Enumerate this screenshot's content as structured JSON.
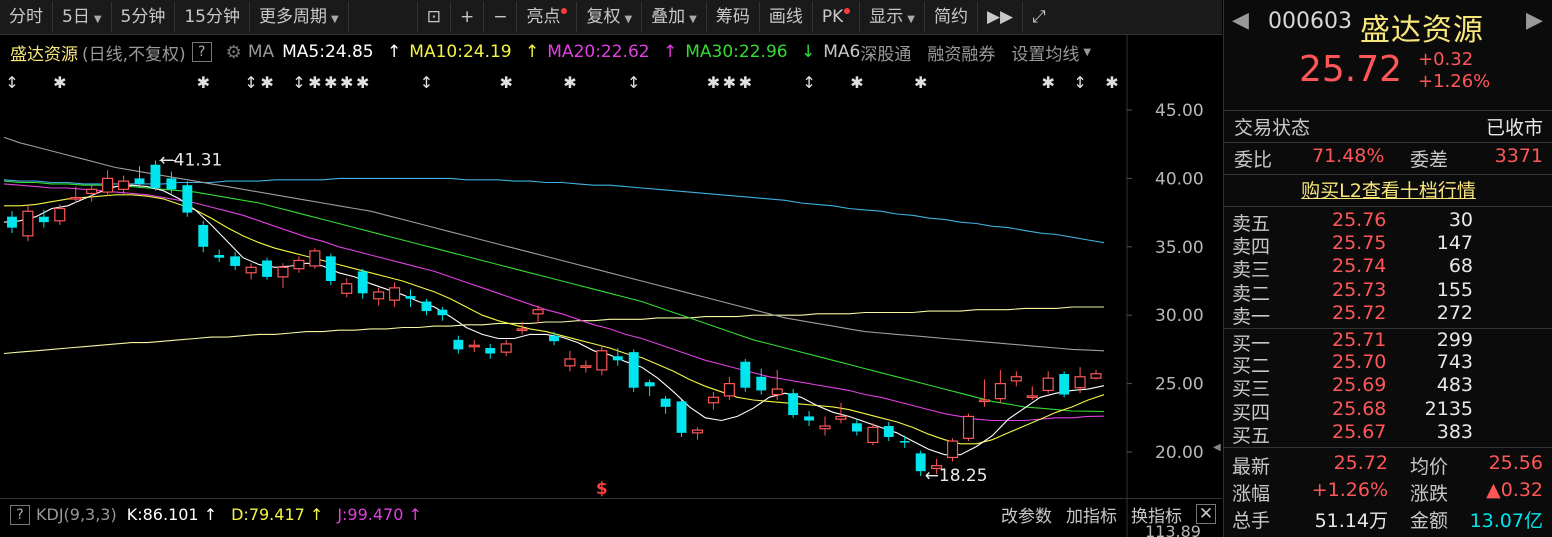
{
  "toolbar": {
    "left": [
      "分时",
      "5日",
      "5分钟",
      "15分钟",
      "更多周期"
    ],
    "tools": [
      "亮点",
      "复权",
      "叠加",
      "筹码",
      "画线",
      "PK",
      "显示",
      "简约"
    ]
  },
  "legend": {
    "name": "盛达资源",
    "mode": "(日线,不复权)",
    "qmark": "?",
    "ma_label": "MA",
    "ma5": "MA5:24.85",
    "ma10": "MA10:24.19",
    "ma20": "MA20:22.62",
    "ma30": "MA30:22.96",
    "ma60": "MA6",
    "links": [
      "深股通",
      "融资融券",
      "设置均线"
    ],
    "colors": {
      "ma5": "#ffffff",
      "ma10": "#f5f542",
      "ma20": "#e040e0",
      "ma30": "#33dd33",
      "ma60": "#9e9e9e",
      "ma120": "#3fb0e0",
      "ma250": "#f5f5a0"
    }
  },
  "kdj": {
    "name": "KDJ(9,3,3)",
    "k": "K:86.101",
    "d": "D:79.417",
    "j": "J:99.470",
    "tools": [
      "改参数",
      "加指标",
      "换指标"
    ],
    "axis_label": "113.89"
  },
  "chart_data": {
    "type": "candlestick",
    "y_ticks": [
      "45.00",
      "40.00",
      "35.00",
      "30.00",
      "25.00",
      "20.00"
    ],
    "ylim": [
      18.25,
      45.0
    ],
    "annotations": {
      "high": "41.31",
      "low": "18.25"
    },
    "marker_symbol": "$",
    "up_color": "#ff5757",
    "down_color": "#00e5ee",
    "candles": [
      {
        "o": 37.2,
        "c": 36.4,
        "h": 37.6,
        "l": 36.0
      },
      {
        "o": 35.8,
        "c": 37.6,
        "h": 38.0,
        "l": 35.4
      },
      {
        "o": 37.2,
        "c": 36.8,
        "h": 37.7,
        "l": 36.4
      },
      {
        "o": 36.9,
        "c": 37.8,
        "h": 38.1,
        "l": 36.6
      },
      {
        "o": 38.6,
        "c": 38.6,
        "h": 39.4,
        "l": 38.2
      },
      {
        "o": 38.9,
        "c": 39.2,
        "h": 39.6,
        "l": 38.3
      },
      {
        "o": 39.0,
        "c": 40.0,
        "h": 40.6,
        "l": 38.7
      },
      {
        "o": 39.2,
        "c": 39.8,
        "h": 40.2,
        "l": 38.8
      },
      {
        "o": 40.0,
        "c": 39.6,
        "h": 40.9,
        "l": 39.3
      },
      {
        "o": 41.0,
        "c": 39.3,
        "h": 41.31,
        "l": 39.1
      },
      {
        "o": 40.0,
        "c": 39.2,
        "h": 40.5,
        "l": 38.9
      },
      {
        "o": 39.5,
        "c": 37.5,
        "h": 39.8,
        "l": 37.2
      },
      {
        "o": 36.6,
        "c": 35.0,
        "h": 36.9,
        "l": 34.6
      },
      {
        "o": 34.4,
        "c": 34.2,
        "h": 34.8,
        "l": 33.9
      },
      {
        "o": 34.3,
        "c": 33.6,
        "h": 34.6,
        "l": 33.3
      },
      {
        "o": 33.1,
        "c": 33.5,
        "h": 33.8,
        "l": 32.6
      },
      {
        "o": 34.0,
        "c": 32.8,
        "h": 34.2,
        "l": 32.6
      },
      {
        "o": 32.8,
        "c": 33.5,
        "h": 33.8,
        "l": 32.0
      },
      {
        "o": 33.4,
        "c": 34.0,
        "h": 34.3,
        "l": 33.1
      },
      {
        "o": 33.6,
        "c": 34.7,
        "h": 34.9,
        "l": 33.4
      },
      {
        "o": 34.3,
        "c": 32.5,
        "h": 34.5,
        "l": 32.2
      },
      {
        "o": 31.6,
        "c": 32.3,
        "h": 32.7,
        "l": 31.3
      },
      {
        "o": 33.2,
        "c": 31.6,
        "h": 33.4,
        "l": 31.2
      },
      {
        "o": 31.2,
        "c": 31.7,
        "h": 32.0,
        "l": 30.7
      },
      {
        "o": 31.1,
        "c": 32.0,
        "h": 32.4,
        "l": 30.6
      },
      {
        "o": 31.4,
        "c": 31.2,
        "h": 31.9,
        "l": 30.6
      },
      {
        "o": 31.0,
        "c": 30.3,
        "h": 31.2,
        "l": 30.0
      },
      {
        "o": 30.4,
        "c": 30.0,
        "h": 30.6,
        "l": 29.6
      },
      {
        "o": 28.2,
        "c": 27.5,
        "h": 28.5,
        "l": 27.2
      },
      {
        "o": 27.8,
        "c": 27.8,
        "h": 28.2,
        "l": 27.3
      },
      {
        "o": 27.6,
        "c": 27.2,
        "h": 27.9,
        "l": 26.8
      },
      {
        "o": 27.3,
        "c": 27.9,
        "h": 28.2,
        "l": 27.0
      },
      {
        "o": 29.0,
        "c": 29.0,
        "h": 29.5,
        "l": 28.6
      },
      {
        "o": 30.1,
        "c": 30.4,
        "h": 30.7,
        "l": 29.4
      },
      {
        "o": 28.5,
        "c": 28.1,
        "h": 28.8,
        "l": 27.8
      },
      {
        "o": 26.3,
        "c": 26.8,
        "h": 27.4,
        "l": 25.9
      },
      {
        "o": 26.3,
        "c": 26.3,
        "h": 26.7,
        "l": 25.8
      },
      {
        "o": 26.0,
        "c": 27.4,
        "h": 27.8,
        "l": 25.6
      },
      {
        "o": 27.0,
        "c": 26.7,
        "h": 27.6,
        "l": 26.3
      },
      {
        "o": 27.3,
        "c": 24.7,
        "h": 27.5,
        "l": 24.4
      },
      {
        "o": 25.1,
        "c": 24.8,
        "h": 25.3,
        "l": 24.1
      },
      {
        "o": 23.9,
        "c": 23.3,
        "h": 24.1,
        "l": 22.8
      },
      {
        "o": 23.7,
        "c": 21.4,
        "h": 23.8,
        "l": 21.1
      },
      {
        "o": 21.4,
        "c": 21.6,
        "h": 21.8,
        "l": 20.9
      },
      {
        "o": 23.6,
        "c": 24.0,
        "h": 24.4,
        "l": 23.1
      },
      {
        "o": 24.1,
        "c": 25.0,
        "h": 25.5,
        "l": 23.8
      },
      {
        "o": 26.6,
        "c": 24.7,
        "h": 26.8,
        "l": 24.4
      },
      {
        "o": 25.5,
        "c": 24.5,
        "h": 26.1,
        "l": 24.2
      },
      {
        "o": 24.2,
        "c": 24.6,
        "h": 26.0,
        "l": 23.8
      },
      {
        "o": 24.3,
        "c": 22.7,
        "h": 24.6,
        "l": 22.5
      },
      {
        "o": 22.6,
        "c": 22.3,
        "h": 23.0,
        "l": 21.9
      },
      {
        "o": 21.7,
        "c": 21.9,
        "h": 22.6,
        "l": 21.2
      },
      {
        "o": 22.4,
        "c": 22.6,
        "h": 23.6,
        "l": 22.1
      },
      {
        "o": 22.1,
        "c": 21.5,
        "h": 22.4,
        "l": 21.2
      },
      {
        "o": 20.7,
        "c": 21.8,
        "h": 22.1,
        "l": 20.5
      },
      {
        "o": 21.9,
        "c": 21.1,
        "h": 22.2,
        "l": 20.8
      },
      {
        "o": 20.8,
        "c": 20.7,
        "h": 21.2,
        "l": 20.3
      },
      {
        "o": 19.9,
        "c": 18.6,
        "h": 20.1,
        "l": 18.25
      },
      {
        "o": 18.8,
        "c": 19.0,
        "h": 19.5,
        "l": 18.4
      },
      {
        "o": 19.6,
        "c": 20.8,
        "h": 21.0,
        "l": 19.3
      },
      {
        "o": 21.0,
        "c": 22.6,
        "h": 22.8,
        "l": 20.8
      },
      {
        "o": 23.8,
        "c": 23.8,
        "h": 25.3,
        "l": 23.3
      },
      {
        "o": 23.9,
        "c": 25.0,
        "h": 26.0,
        "l": 23.6
      },
      {
        "o": 25.2,
        "c": 25.5,
        "h": 25.9,
        "l": 24.8
      },
      {
        "o": 24.1,
        "c": 24.1,
        "h": 24.8,
        "l": 23.8
      },
      {
        "o": 24.5,
        "c": 25.4,
        "h": 25.9,
        "l": 24.3
      },
      {
        "o": 25.7,
        "c": 24.2,
        "h": 25.9,
        "l": 24.0
      },
      {
        "o": 24.7,
        "c": 25.5,
        "h": 26.2,
        "l": 24.3
      },
      {
        "o": 25.4,
        "c": 25.72,
        "h": 26.0,
        "l": 25.3
      }
    ],
    "ma_lines": {
      "ma5": [
        36.8,
        36.9,
        37.2,
        37.8,
        38.0,
        38.5,
        39.0,
        39.4,
        39.5,
        39.4,
        39.1,
        38.5,
        37.7,
        36.6,
        35.4,
        34.2,
        33.7,
        33.5,
        33.6,
        33.8,
        33.6,
        33.1,
        32.8,
        32.3,
        31.9,
        31.5,
        31.0,
        30.6,
        29.9,
        29.1,
        28.6,
        28.3,
        28.3,
        28.6,
        28.6,
        28.4,
        28.0,
        27.4,
        27.1,
        26.6,
        26.2,
        25.4,
        24.4,
        23.3,
        22.5,
        22.3,
        22.6,
        23.2,
        24.0,
        24.3,
        24.0,
        23.4,
        22.9,
        22.6,
        22.2,
        21.8,
        21.4,
        20.8,
        20.2,
        19.8,
        19.8,
        20.4,
        21.2,
        22.4,
        23.2,
        24.0,
        24.3,
        24.5,
        24.6,
        24.85
      ],
      "ma10": [
        38.0,
        38.0,
        38.1,
        38.3,
        38.5,
        38.6,
        38.7,
        38.8,
        38.8,
        38.7,
        38.5,
        38.1,
        37.7,
        37.1,
        36.4,
        35.8,
        35.3,
        34.9,
        34.6,
        34.3,
        34.0,
        33.7,
        33.4,
        33.1,
        32.8,
        32.5,
        32.1,
        31.7,
        31.2,
        30.6,
        30.0,
        29.6,
        29.3,
        29.0,
        28.8,
        28.5,
        28.2,
        27.9,
        27.6,
        27.2,
        26.9,
        26.4,
        25.9,
        25.3,
        24.8,
        24.4,
        24.0,
        23.8,
        23.7,
        23.6,
        23.5,
        23.4,
        23.3,
        23.1,
        22.8,
        22.5,
        22.2,
        21.8,
        21.3,
        20.9,
        20.6,
        20.6,
        20.9,
        21.4,
        21.9,
        22.4,
        22.9,
        23.3,
        23.8,
        24.19
      ],
      "ma20": [
        39.6,
        39.5,
        39.4,
        39.3,
        39.3,
        39.2,
        39.1,
        39.0,
        38.9,
        38.8,
        38.6,
        38.4,
        38.2,
        37.9,
        37.6,
        37.3,
        36.9,
        36.5,
        36.1,
        35.7,
        35.4,
        35.0,
        34.7,
        34.4,
        34.1,
        33.8,
        33.5,
        33.2,
        32.8,
        32.4,
        32.0,
        31.6,
        31.2,
        30.8,
        30.4,
        30.1,
        29.7,
        29.3,
        29.0,
        28.6,
        28.3,
        27.9,
        27.5,
        27.1,
        26.7,
        26.4,
        26.1,
        25.8,
        25.5,
        25.3,
        25.1,
        24.9,
        24.7,
        24.5,
        24.2,
        24.0,
        23.7,
        23.4,
        23.1,
        22.8,
        22.6,
        22.4,
        22.3,
        22.3,
        22.3,
        22.4,
        22.5,
        22.5,
        22.6,
        22.62
      ],
      "ma30": [
        39.8,
        39.7,
        39.7,
        39.6,
        39.6,
        39.5,
        39.5,
        39.4,
        39.4,
        39.3,
        39.2,
        39.1,
        39.0,
        38.8,
        38.6,
        38.4,
        38.2,
        37.9,
        37.6,
        37.3,
        37.0,
        36.7,
        36.4,
        36.1,
        35.8,
        35.5,
        35.2,
        34.9,
        34.6,
        34.3,
        34.0,
        33.7,
        33.4,
        33.1,
        32.8,
        32.5,
        32.2,
        31.9,
        31.6,
        31.3,
        31.0,
        30.6,
        30.2,
        29.8,
        29.4,
        29.0,
        28.6,
        28.2,
        27.9,
        27.6,
        27.3,
        27.0,
        26.7,
        26.4,
        26.1,
        25.8,
        25.5,
        25.2,
        24.9,
        24.6,
        24.3,
        24.0,
        23.7,
        23.5,
        23.3,
        23.2,
        23.1,
        23.0,
        22.98,
        22.96
      ],
      "ma60": [
        43.0,
        42.6,
        42.3,
        42.0,
        41.7,
        41.4,
        41.1,
        40.8,
        40.6,
        40.4,
        40.2,
        40.0,
        39.8,
        39.6,
        39.4,
        39.2,
        39.0,
        38.8,
        38.6,
        38.4,
        38.2,
        38.0,
        37.8,
        37.6,
        37.3,
        37.0,
        36.7,
        36.4,
        36.1,
        35.8,
        35.5,
        35.2,
        34.9,
        34.6,
        34.3,
        34.0,
        33.7,
        33.4,
        33.1,
        32.8,
        32.5,
        32.2,
        31.9,
        31.6,
        31.3,
        31.0,
        30.7,
        30.4,
        30.1,
        29.8,
        29.6,
        29.4,
        29.2,
        29.0,
        28.8,
        28.7,
        28.6,
        28.5,
        28.4,
        28.3,
        28.2,
        28.1,
        28.0,
        27.9,
        27.8,
        27.7,
        27.6,
        27.5,
        27.45,
        27.4
      ],
      "ma120": [
        39.9,
        39.8,
        39.8,
        39.7,
        39.7,
        39.6,
        39.6,
        39.6,
        39.6,
        39.6,
        39.6,
        39.7,
        39.7,
        39.7,
        39.8,
        39.8,
        39.8,
        39.9,
        39.9,
        39.9,
        39.9,
        40.0,
        40.0,
        40.0,
        40.0,
        40.0,
        40.0,
        40.0,
        40.0,
        39.9,
        39.9,
        39.9,
        39.8,
        39.8,
        39.7,
        39.7,
        39.6,
        39.5,
        39.5,
        39.4,
        39.3,
        39.2,
        39.1,
        39.0,
        38.9,
        38.8,
        38.7,
        38.6,
        38.5,
        38.4,
        38.2,
        38.1,
        38.0,
        37.8,
        37.7,
        37.6,
        37.4,
        37.3,
        37.1,
        37.0,
        36.8,
        36.7,
        36.5,
        36.4,
        36.2,
        36.0,
        35.9,
        35.7,
        35.5,
        35.3
      ],
      "ma250": [
        27.2,
        27.3,
        27.4,
        27.5,
        27.6,
        27.7,
        27.8,
        27.9,
        28.0,
        28.0,
        28.1,
        28.2,
        28.3,
        28.4,
        28.4,
        28.5,
        28.6,
        28.6,
        28.7,
        28.8,
        28.8,
        28.9,
        28.9,
        29.0,
        29.0,
        29.1,
        29.1,
        29.2,
        29.2,
        29.3,
        29.3,
        29.4,
        29.4,
        29.4,
        29.5,
        29.5,
        29.6,
        29.6,
        29.7,
        29.7,
        29.7,
        29.8,
        29.8,
        29.8,
        29.9,
        29.9,
        29.9,
        30.0,
        30.0,
        30.0,
        30.0,
        30.1,
        30.1,
        30.1,
        30.2,
        30.2,
        30.2,
        30.2,
        30.3,
        30.3,
        30.3,
        30.4,
        30.4,
        30.4,
        30.5,
        30.5,
        30.5,
        30.6,
        30.6,
        30.6
      ]
    }
  },
  "quote": {
    "code": "000603",
    "name": "盛达资源",
    "price": "25.72",
    "change": "+0.32",
    "change_pct": "+1.26%",
    "status_label": "交易状态",
    "status_value": "已收市",
    "weibi_label": "委比",
    "weibi_value": "71.48%",
    "weicha_label": "委差",
    "weicha_value": "3371",
    "l2_link": "购买L2查看十档行情",
    "asks": [
      {
        "label": "卖五",
        "price": "25.76",
        "vol": "30"
      },
      {
        "label": "卖四",
        "price": "25.75",
        "vol": "147"
      },
      {
        "label": "卖三",
        "price": "25.74",
        "vol": "68"
      },
      {
        "label": "卖二",
        "price": "25.73",
        "vol": "155"
      },
      {
        "label": "卖一",
        "price": "25.72",
        "vol": "272"
      }
    ],
    "bids": [
      {
        "label": "买一",
        "price": "25.71",
        "vol": "299"
      },
      {
        "label": "买二",
        "price": "25.70",
        "vol": "743"
      },
      {
        "label": "买三",
        "price": "25.69",
        "vol": "483"
      },
      {
        "label": "买四",
        "price": "25.68",
        "vol": "2135"
      },
      {
        "label": "买五",
        "price": "25.67",
        "vol": "383"
      }
    ],
    "stats": [
      {
        "a": "最新",
        "b": "25.72",
        "c": "均价",
        "d": "25.56"
      },
      {
        "a": "涨幅",
        "b": "+1.26%",
        "c": "涨跌",
        "d": "▲0.32"
      },
      {
        "a": "总手",
        "b": "51.14万",
        "c": "金额",
        "d": "13.07亿"
      }
    ]
  }
}
